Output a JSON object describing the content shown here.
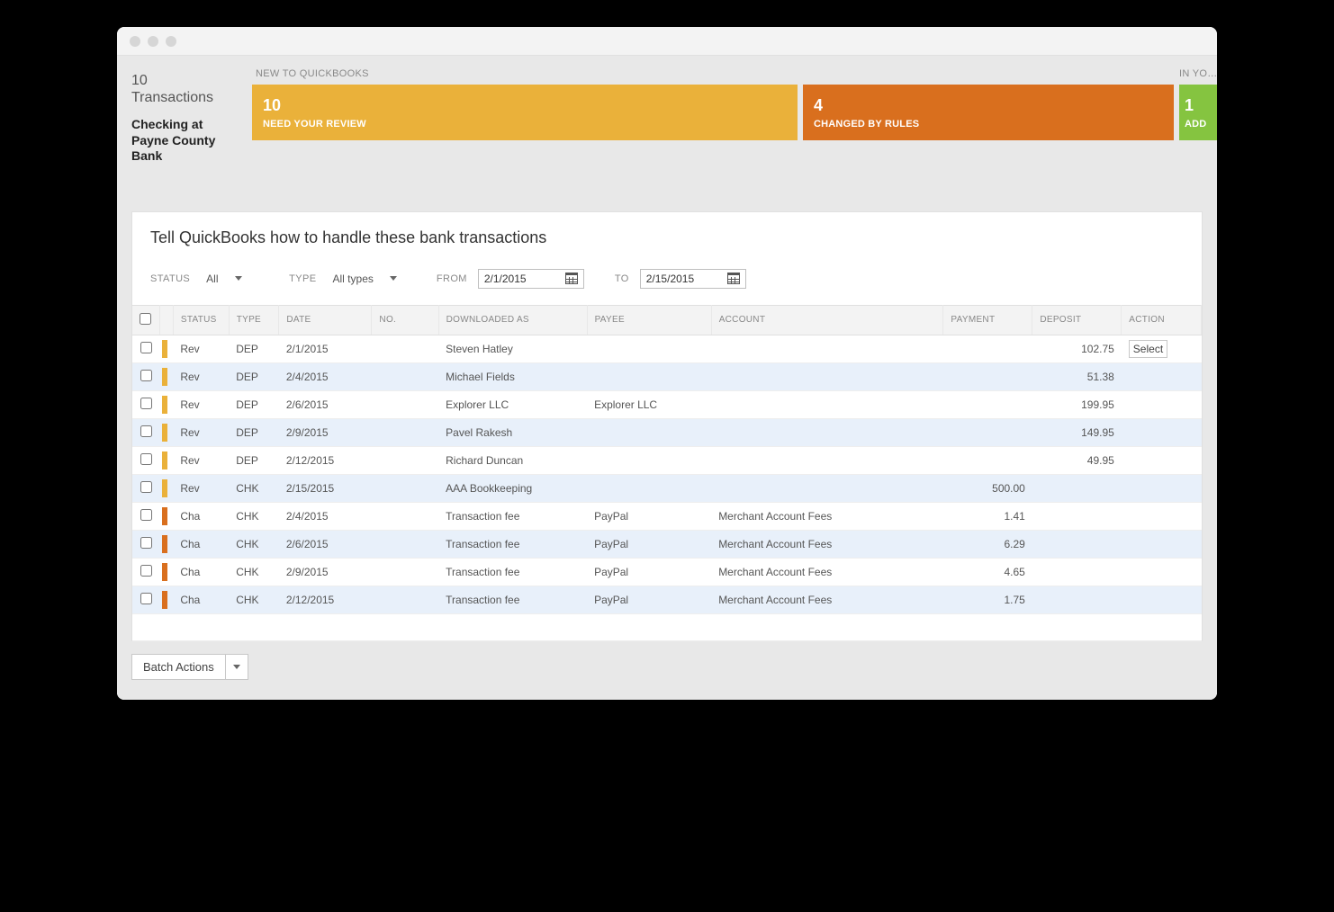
{
  "summary": {
    "count_text": "10",
    "count_label": "Transactions",
    "account_name": "Checking at Payne County Bank"
  },
  "tab_labels": {
    "left": "NEW TO QUICKBOOKS",
    "right": "IN YO…"
  },
  "tiles": {
    "review": {
      "num": "10",
      "cap": "NEED YOUR REVIEW"
    },
    "changed": {
      "num": "4",
      "cap": "CHANGED BY RULES"
    },
    "add": {
      "num": "1",
      "cap": "ADD"
    }
  },
  "panel_title": "Tell QuickBooks how to handle these bank transactions",
  "filters": {
    "status_label": "STATUS",
    "status_value": "All",
    "type_label": "TYPE",
    "type_value": "All types",
    "from_label": "FROM",
    "from_value": "2/1/2015",
    "to_label": "TO",
    "to_value": "2/15/2015"
  },
  "columns": {
    "status": "STATUS",
    "type": "TYPE",
    "date": "DATE",
    "no": "NO.",
    "downloaded_as": "DOWNLOADED AS",
    "payee": "PAYEE",
    "account": "ACCOUNT",
    "payment": "PAYMENT",
    "deposit": "DEPOSIT",
    "action": "ACTION"
  },
  "rows": [
    {
      "chip": "yellow",
      "status": "Rev",
      "type": "DEP",
      "date": "2/1/2015",
      "no": "",
      "downloaded_as": "Steven Hatley",
      "payee": "",
      "account": "",
      "payment": "",
      "deposit": "102.75",
      "action": "Select"
    },
    {
      "chip": "yellow",
      "status": "Rev",
      "type": "DEP",
      "date": "2/4/2015",
      "no": "",
      "downloaded_as": "Michael Fields",
      "payee": "",
      "account": "",
      "payment": "",
      "deposit": "51.38",
      "action": ""
    },
    {
      "chip": "yellow",
      "status": "Rev",
      "type": "DEP",
      "date": "2/6/2015",
      "no": "",
      "downloaded_as": "Explorer LLC",
      "payee": "Explorer LLC",
      "account": "",
      "payment": "",
      "deposit": "199.95",
      "action": ""
    },
    {
      "chip": "yellow",
      "status": "Rev",
      "type": "DEP",
      "date": "2/9/2015",
      "no": "",
      "downloaded_as": "Pavel Rakesh",
      "payee": "",
      "account": "",
      "payment": "",
      "deposit": "149.95",
      "action": ""
    },
    {
      "chip": "yellow",
      "status": "Rev",
      "type": "DEP",
      "date": "2/12/2015",
      "no": "",
      "downloaded_as": "Richard Duncan",
      "payee": "",
      "account": "",
      "payment": "",
      "deposit": "49.95",
      "action": ""
    },
    {
      "chip": "yellow",
      "status": "Rev",
      "type": "CHK",
      "date": "2/15/2015",
      "no": "",
      "downloaded_as": "AAA Bookkeeping",
      "payee": "",
      "account": "",
      "payment": "500.00",
      "deposit": "",
      "action": ""
    },
    {
      "chip": "orange",
      "status": "Cha",
      "type": "CHK",
      "date": "2/4/2015",
      "no": "",
      "downloaded_as": "Transaction fee",
      "payee": "PayPal",
      "account": "Merchant Account Fees",
      "payment": "1.41",
      "deposit": "",
      "action": ""
    },
    {
      "chip": "orange",
      "status": "Cha",
      "type": "CHK",
      "date": "2/6/2015",
      "no": "",
      "downloaded_as": "Transaction fee",
      "payee": "PayPal",
      "account": "Merchant Account Fees",
      "payment": "6.29",
      "deposit": "",
      "action": ""
    },
    {
      "chip": "orange",
      "status": "Cha",
      "type": "CHK",
      "date": "2/9/2015",
      "no": "",
      "downloaded_as": "Transaction fee",
      "payee": "PayPal",
      "account": "Merchant Account Fees",
      "payment": "4.65",
      "deposit": "",
      "action": ""
    },
    {
      "chip": "orange",
      "status": "Cha",
      "type": "CHK",
      "date": "2/12/2015",
      "no": "",
      "downloaded_as": "Transaction fee",
      "payee": "PayPal",
      "account": "Merchant Account Fees",
      "payment": "1.75",
      "deposit": "",
      "action": ""
    }
  ],
  "batch_actions_label": "Batch Actions"
}
